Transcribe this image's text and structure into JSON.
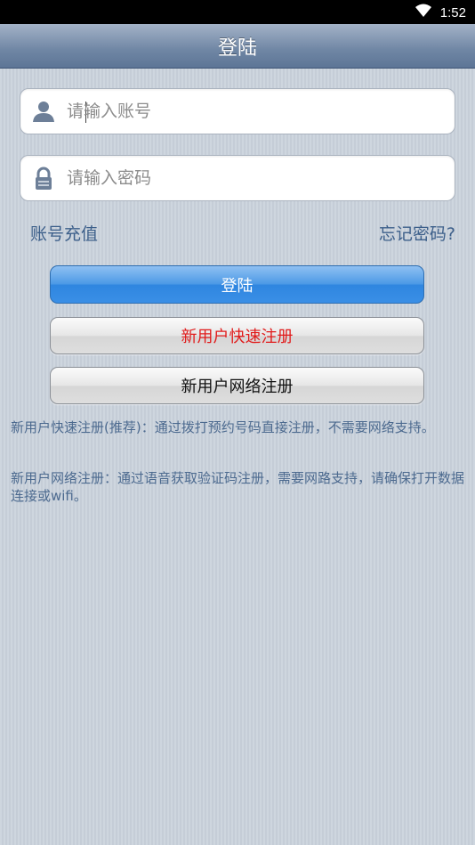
{
  "status_bar": {
    "time": "1:52",
    "icons": [
      "wifi-icon"
    ]
  },
  "header": {
    "title": "登陆"
  },
  "form": {
    "account_placeholder": "请输入账号",
    "password_placeholder": "请输入密码",
    "account_icon": "user-icon",
    "password_icon": "lock-icon"
  },
  "links": {
    "recharge": "账号充值",
    "forgot_password": "忘记密码?"
  },
  "buttons": {
    "login": "登陆",
    "quick_register": "新用户快速注册",
    "network_register": "新用户网络注册"
  },
  "descriptions": {
    "quick_register_info": "新用户快速注册(推荐)：通过拨打预约号码直接注册，不需要网络支持。",
    "network_register_info": "新用户网络注册：通过语音获取验证码注册，需要网路支持，请确保打开数据连接或wifi。"
  },
  "colors": {
    "accent_blue": "#3a8fe6",
    "quick_register_text": "#e11b1b",
    "link_text": "#3c5f8a",
    "description_text": "#4c6a8f"
  }
}
